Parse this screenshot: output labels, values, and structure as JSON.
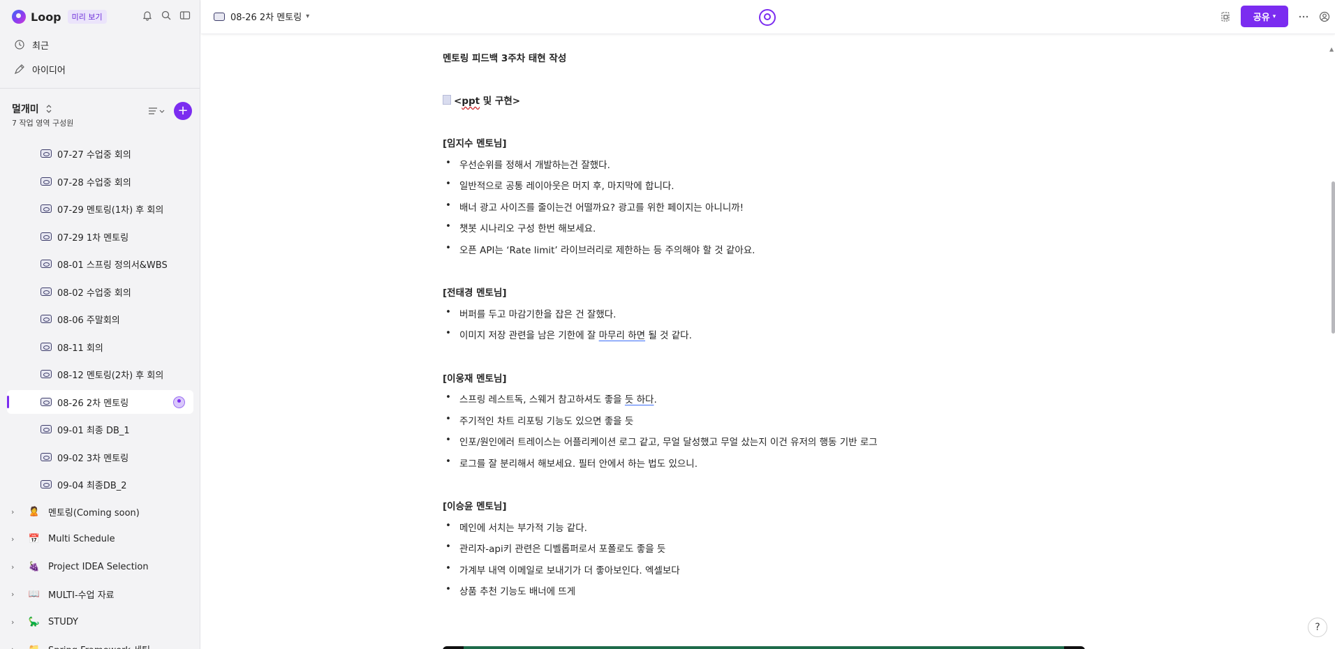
{
  "sidebar": {
    "brand": "Loop",
    "preview_badge": "미리 보기",
    "nav": [
      {
        "label": "최근",
        "icon": "clock-icon"
      },
      {
        "label": "아이디어",
        "icon": "idea-pen-icon"
      }
    ],
    "workspace": {
      "name": "멀개미",
      "members": "7 작업 영역 구성원"
    },
    "pages": [
      {
        "label": "07-27 수업중 회의",
        "active": false
      },
      {
        "label": "07-28 수업중 회의",
        "active": false
      },
      {
        "label": "07-29 멘토링(1차) 후 회의",
        "active": false
      },
      {
        "label": "07-29 1차 멘토링",
        "active": false
      },
      {
        "label": "08-01 스프링 정의서&WBS",
        "active": false
      },
      {
        "label": "08-02 수업중 회의",
        "active": false
      },
      {
        "label": "08-06 주말회의",
        "active": false
      },
      {
        "label": "08-11 회의",
        "active": false
      },
      {
        "label": "08-12 멘토링(2차) 후 회의",
        "active": false
      },
      {
        "label": "08-26 2차 멘토링",
        "active": true
      },
      {
        "label": "09-01 최종 DB_1",
        "active": false
      },
      {
        "label": "09-02 3차 멘토링",
        "active": false
      },
      {
        "label": "09-04 최종DB_2",
        "active": false
      }
    ],
    "workspaces": [
      {
        "label": "멘토링(Coming soon)",
        "icon": "person-icon",
        "emoji": "🙎"
      },
      {
        "label": "Multi Schedule",
        "icon": "calendar-icon",
        "emoji": "📅"
      },
      {
        "label": "Project IDEA Selection",
        "icon": "grapes-icon",
        "emoji": "🍇"
      },
      {
        "label": "MULTI-수업 자료",
        "icon": "book-icon",
        "emoji": "📖"
      },
      {
        "label": "STUDY",
        "icon": "dinosaur-icon",
        "emoji": "🦕"
      },
      {
        "label": "Spring Framework 세팅",
        "icon": "folder-icon",
        "emoji": "📁"
      }
    ]
  },
  "topbar": {
    "title": "08-26 2차 멘토링",
    "share_label": "공유"
  },
  "document": {
    "heading": "멘토링 피드백 3주차 태현 작성",
    "ppt_open": "<",
    "ppt_word": "ppt",
    "ppt_rest": " 및 구현>",
    "sections": [
      {
        "title": "[임지수 멘토님]",
        "items": [
          "우선순위를 정해서 개발하는건 잘했다.",
          "일반적으로 공통 레이아웃은 머지 후, 마지막에 합니다.",
          "배너 광고 사이즈를 줄이는건 어떨까요? 광고를 위한 페이지는 아니니까!",
          "챗봇 시나리오 구성 한번 해보세요.",
          "오픈 API는 ‘Rate limit’ 라이브러리로 제한하는 등 주의해야 할 것 같아요."
        ]
      },
      {
        "title": "[전태경 멘토님]",
        "items": [
          "버퍼를 두고 마감기한을 잡은 건 잘했다.",
          "이미지 저장 관련을 남은 기한에 잘 ",
          "마무리 하면",
          " 될 것 같다."
        ]
      },
      {
        "title": "[이웅재 멘토님]",
        "items": [
          "스프링 레스트독, 스웨거 참고하셔도 좋을 ",
          "듯 하다",
          ".",
          "주기적인 차트 리포팅 기능도 있으면 좋을 듯",
          "인포/원인에러 트레이스는 어플리케이션 로그 같고, 무얼 달성했고 무얼 샀는지 이건 유저의 행동 기반 로그",
          "로그를 잘 분리해서 해보세요. 필터 안에서 하는 법도 있으니."
        ]
      },
      {
        "title": "[이승윤 멘토님]",
        "items": [
          "메인에 서치는 부가적 기능 같다.",
          "관리자-api키 관련은 디벨롭퍼로서 포폴로도 좋을 듯",
          "가계부 내역 이메일로 보내기가 더 좋아보인다. 엑셀보다",
          "상품 추천 기능도 배너에 뜨게"
        ]
      }
    ]
  },
  "help_label": "?",
  "colors": {
    "accent": "#7b2cf0",
    "sidebar_bg": "#f3f3f5"
  }
}
